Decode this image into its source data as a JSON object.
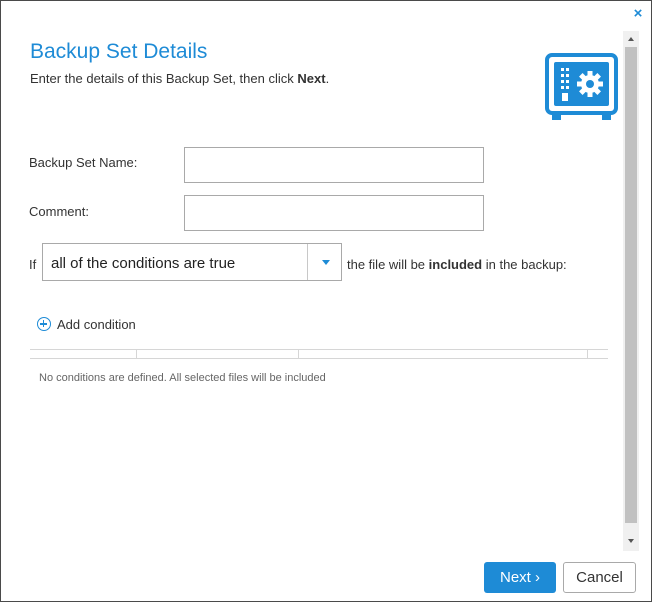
{
  "dialog": {
    "close_glyph": "×",
    "title": "Backup Set Details",
    "subtitle_prefix": "Enter the details of this Backup Set, then click ",
    "subtitle_bold": "Next",
    "subtitle_suffix": ".",
    "icon": "safe-gear-icon",
    "accent_color": "#1e8bd6"
  },
  "form": {
    "name_label": "Backup Set Name:",
    "name_value": "",
    "comment_label": "Comment:",
    "comment_value": "",
    "if_label": "If",
    "condition_select": "all of the conditions are true",
    "after_prefix": "the file will be ",
    "after_bold": "included",
    "after_suffix": " in the backup:"
  },
  "conditions": {
    "add_label": "Add condition",
    "empty_message": "No conditions are defined. All selected files will be included"
  },
  "buttons": {
    "next": "Next ›",
    "cancel": "Cancel"
  }
}
